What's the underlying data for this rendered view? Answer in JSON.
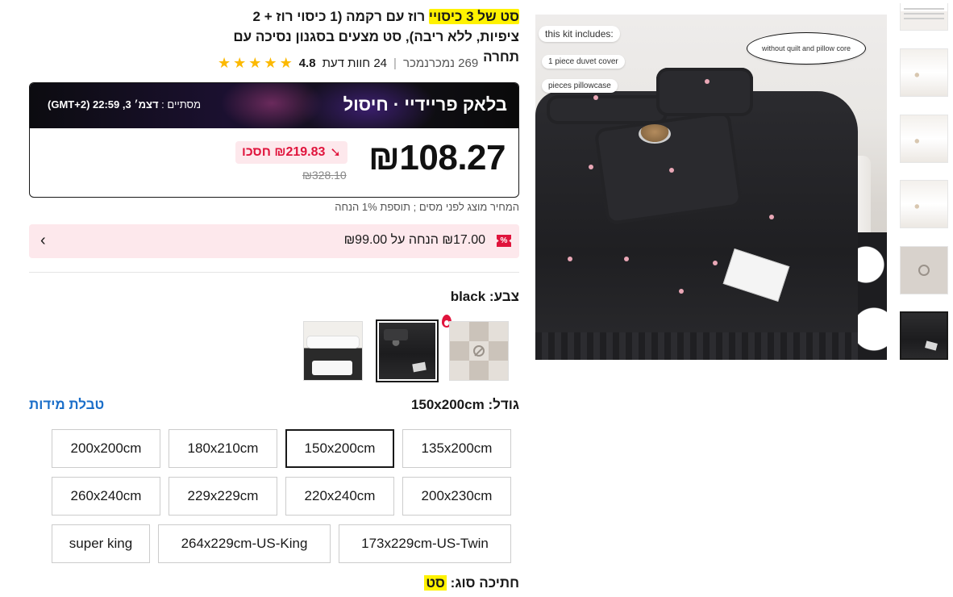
{
  "product": {
    "title_highlight": "סט של 3 כיסויי",
    "title_rest": " רוז עם רקמה (1 כיסוי רוז + 2 ציפיות, ללא ריבה), סט מצעים בסגנון נסיכה עם תחרה",
    "rating": "4.8",
    "reviews": "24 חוות דעת",
    "sold": "269 נמכרנמכר",
    "star_color": "#fcb900"
  },
  "deal": {
    "banner_title": "בלאק פריידיי · חיסול",
    "ends_label": "מסתיים :",
    "ends_value": "דצמ׳ 3, 22:59 (GMT+2)",
    "price": "₪108.27",
    "save_label": "₪219.83 חסכו",
    "old_price": "₪328.10",
    "tax_note": "המחיר מוצג לפני מסים ; תוספת 1% הנחה",
    "accent_color": "#e0143c"
  },
  "coupon": {
    "tag": "%",
    "text": "₪17.00 הנחה על ₪99.00",
    "chevron": "‹"
  },
  "color": {
    "label": "צבע:",
    "value": "black",
    "swatches": [
      "placeholder",
      "black",
      "white-black"
    ],
    "selected_index": 1
  },
  "size": {
    "label": "גודל:",
    "value": "150x200cm",
    "chart_link": "טבלת מידות",
    "options": [
      "135x200cm",
      "150x200cm",
      "180x210cm",
      "200x200cm",
      "200x230cm",
      "220x240cm",
      "229x229cm",
      "260x240cm",
      "173x229cm-US-Twin",
      "264x229cm-US-King",
      "super king"
    ],
    "selected": "150x200cm"
  },
  "type": {
    "label": "חתיכה סוג:",
    "value": "סט"
  },
  "main_image": {
    "bubble_includes": "this kit includes:",
    "bubble_cover": "1 piece duvet cover",
    "bubble_cases": "pieces pillowcase",
    "bubble_without": "without quilt and pillow core"
  },
  "thumbnails": {
    "count": 6,
    "selected_index": 5
  }
}
